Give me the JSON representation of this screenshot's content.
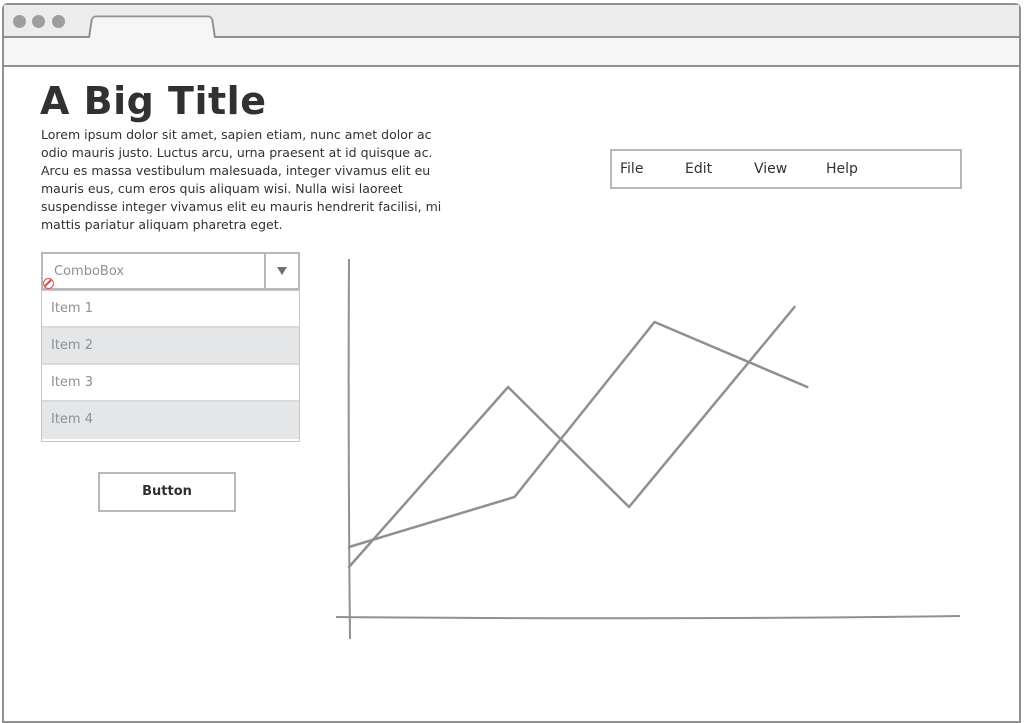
{
  "page": {
    "title": "A Big Title",
    "body_text": "Lorem ipsum dolor sit amet, sapien etiam, nunc amet dolor ac odio mauris justo. Luctus arcu, urna praesent at id quisque ac. Arcu es massa vestibulum malesuada, integer vivamus elit eu mauris eus, cum eros quis aliquam wisi. Nulla wisi laoreet suspendisse integer vivamus elit eu mauris hendrerit facilisi, mi mattis pariatur aliquam pharetra eget."
  },
  "menubar": {
    "items": [
      {
        "label": "File"
      },
      {
        "label": "Edit"
      },
      {
        "label": "View"
      },
      {
        "label": "Help"
      }
    ]
  },
  "combobox": {
    "value": "ComboBox",
    "options": [
      {
        "label": "Item 1",
        "highlighted": false
      },
      {
        "label": "Item 2",
        "highlighted": true
      },
      {
        "label": "Item 3",
        "highlighted": false
      },
      {
        "label": "Item 4",
        "highlighted": true
      }
    ]
  },
  "button": {
    "label": "Button"
  },
  "colors": {
    "frame": "#8e9091",
    "line": "#8e9091",
    "text": "#2f3133",
    "highlight_row": "#e5e6e7"
  },
  "icons": {
    "combo_arrow": "chevron-down-icon",
    "missing": "no-image-icon"
  },
  "chart_data": {
    "type": "line",
    "title": "",
    "xlabel": "",
    "ylabel": "",
    "x": [
      0,
      1,
      2,
      3,
      4
    ],
    "series": [
      {
        "values": [
          1.0,
          4.6,
          2.2,
          6.2,
          null
        ]
      },
      {
        "values": [
          1.4,
          2.4,
          5.9,
          4.6,
          null
        ]
      }
    ],
    "series_points": [
      [
        [
          0,
          1.0
        ],
        [
          1.25,
          4.6
        ],
        [
          2.2,
          2.2
        ],
        [
          3.5,
          6.2
        ]
      ],
      [
        [
          0,
          1.4
        ],
        [
          1.3,
          2.4
        ],
        [
          2.4,
          5.9
        ],
        [
          3.6,
          4.6
        ]
      ]
    ],
    "xlim": [
      0,
      4.8
    ],
    "ylim": [
      0,
      7.2
    ],
    "grid": false
  }
}
